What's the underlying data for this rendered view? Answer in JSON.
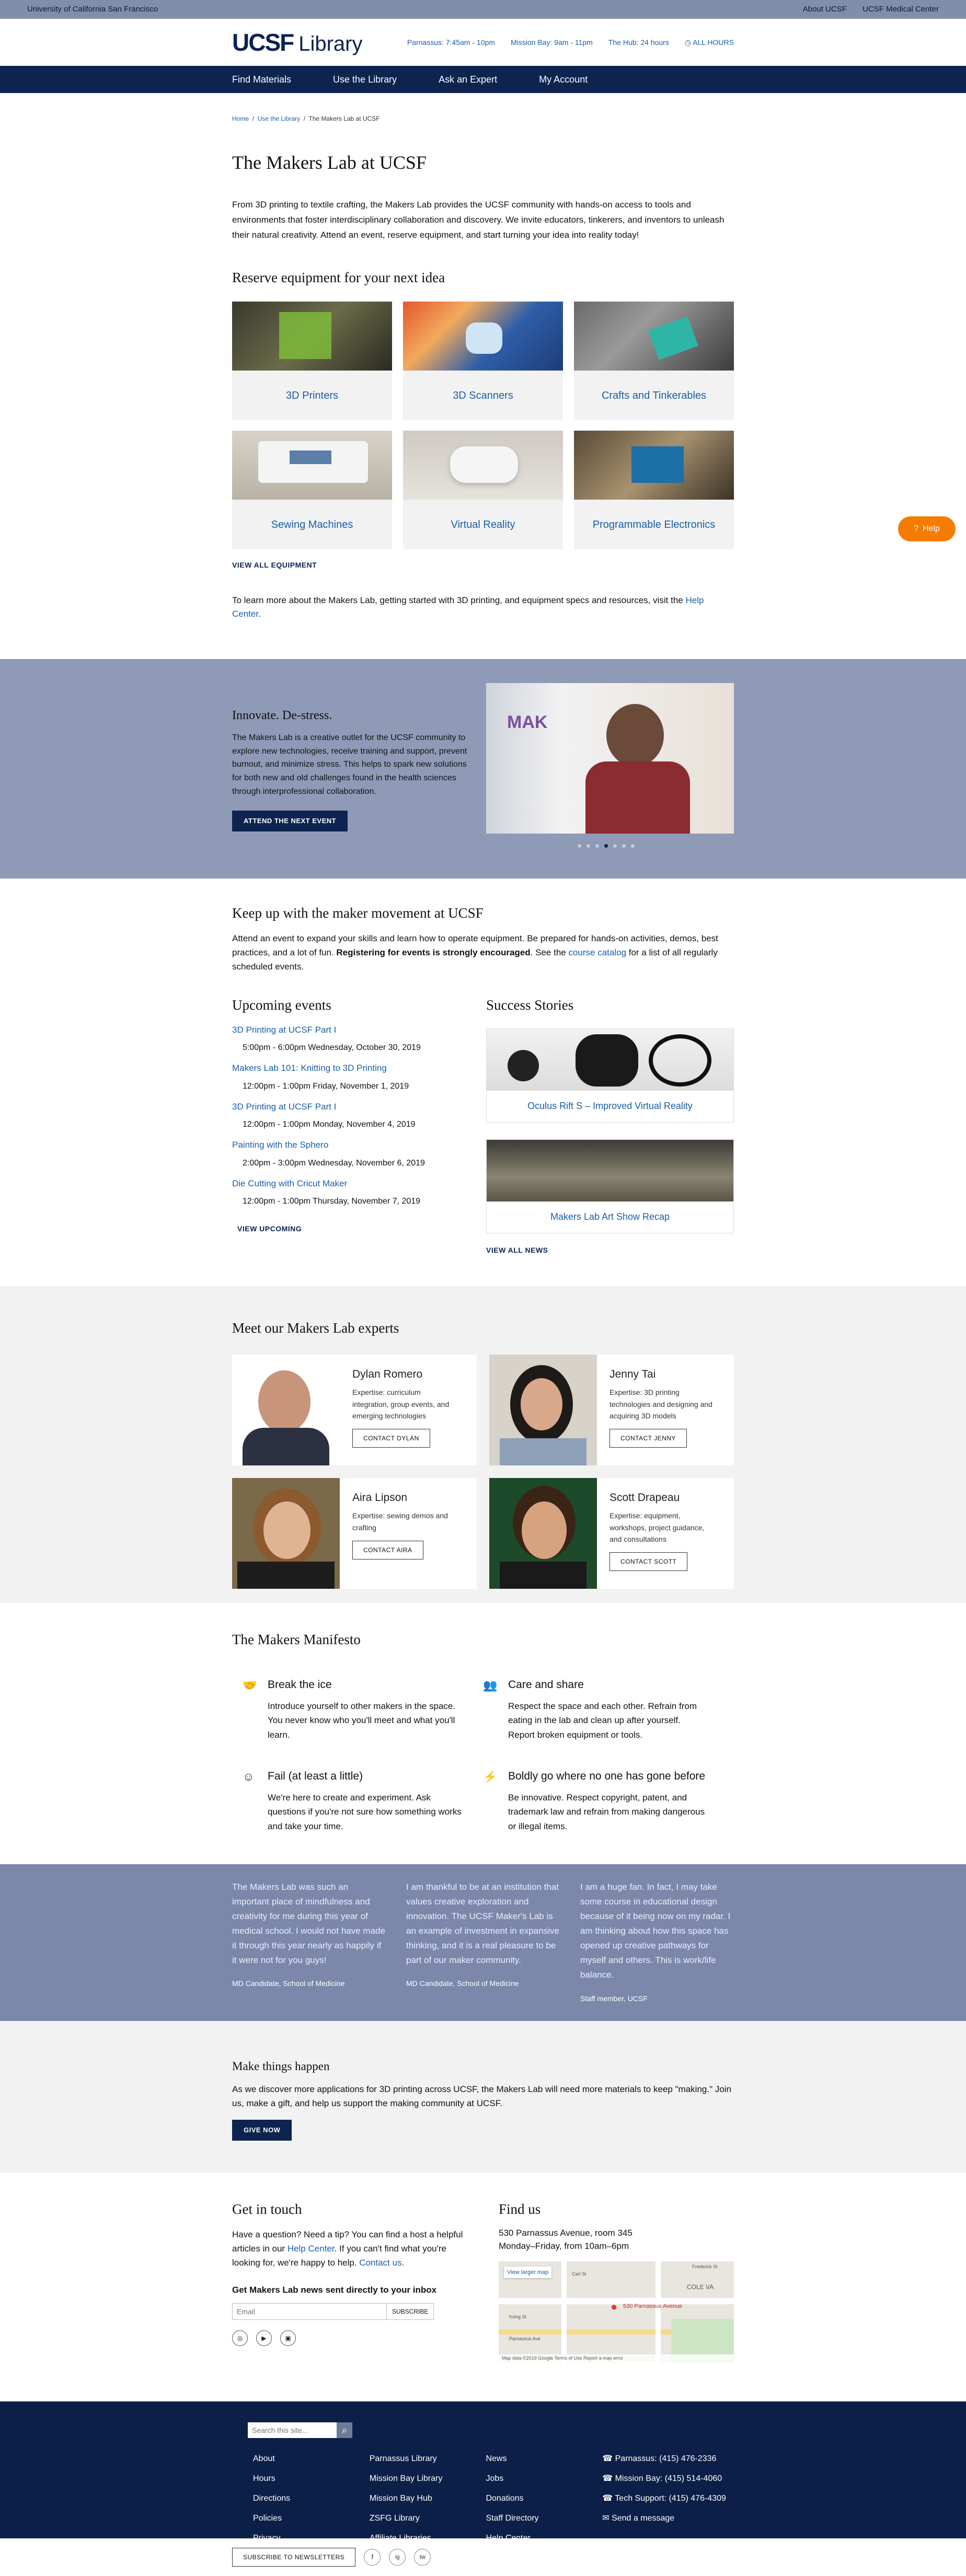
{
  "topbar": {
    "left": "University of California San Francisco",
    "links": [
      "About UCSF",
      "UCSF Medical Center"
    ]
  },
  "header": {
    "logo_ucsf": "UCSF",
    "logo_library": "Library",
    "hours": [
      "Parnassus: 7:45am - 10pm",
      "Mission Bay: 9am - 11pm",
      "The Hub: 24 hours",
      "ALL HOURS"
    ]
  },
  "nav": [
    "Find Materials",
    "Use the Library",
    "Ask an Expert",
    "My Account"
  ],
  "breadcrumb": [
    "Home",
    "Use the Library",
    "The Makers Lab at UCSF"
  ],
  "page_title": "The Makers Lab at UCSF",
  "intro": "From 3D printing to textile crafting, the Makers Lab provides the UCSF community with hands-on access to tools and environments that foster interdisciplinary collaboration and discovery. We invite educators, tinkerers, and inventors to unleash their natural creativity. Attend an event, reserve equipment, and start turning your idea into reality today!",
  "equipment": {
    "heading": "Reserve equipment for your next idea",
    "items": [
      "3D Printers",
      "3D Scanners",
      "Crafts and Tinkerables",
      "Sewing Machines",
      "Virtual Reality",
      "Programmable Electronics"
    ],
    "view_all": "VIEW ALL EQUIPMENT"
  },
  "learn_more": {
    "text": "To learn more about the Makers Lab, getting started with 3D printing, and equipment specs and resources, visit the ",
    "link": "Help Center",
    "end": "."
  },
  "help_button": "Help",
  "innovate": {
    "title": "Innovate. De-stress.",
    "text": "The Makers Lab is a creative outlet for the UCSF community to explore new technologies, receive training and support, prevent burnout, and minimize stress. This helps to spark new solutions for both new and old challenges found in the health sciences through interprofessional collaboration.",
    "button": "ATTEND THE NEXT EVENT",
    "sign": "MAK"
  },
  "keepup": {
    "heading": "Keep up with the maker movement at UCSF",
    "text1": "Attend an event to expand your skills and learn how to operate equipment. Be prepared for hands-on activities, demos, best practices, and a lot of fun. ",
    "bold": "Registering for events is strongly encouraged",
    "text2": ". See the ",
    "link": "course catalog",
    "text3": " for a list of all regularly scheduled events."
  },
  "events": {
    "heading": "Upcoming events",
    "items": [
      {
        "title": "3D Printing at UCSF Part I",
        "time": "5:00pm - 6:00pm Wednesday, October 30, 2019"
      },
      {
        "title": "Makers Lab 101: Knitting to 3D Printing",
        "time": "12:00pm - 1:00pm Friday, November 1, 2019"
      },
      {
        "title": "3D Printing at UCSF Part I",
        "time": "12:00pm - 1:00pm Monday, November 4, 2019"
      },
      {
        "title": "Painting with the Sphero",
        "time": "2:00pm - 3:00pm Wednesday, November 6, 2019"
      },
      {
        "title": "Die Cutting with Cricut Maker",
        "time": "12:00pm - 1:00pm Thursday, November 7, 2019"
      }
    ],
    "view": "VIEW UPCOMING"
  },
  "stories": {
    "heading": "Success Stories",
    "items": [
      "Oculus Rift S – Improved Virtual Reality",
      "Makers Lab Art Show Recap"
    ],
    "view": "VIEW ALL NEWS"
  },
  "experts": {
    "heading": "Meet our Makers Lab experts",
    "items": [
      {
        "name": "Dylan Romero",
        "expertise": "Expertise: curriculum integration, group events, and emerging technologies",
        "button": "CONTACT DYLAN"
      },
      {
        "name": "Jenny Tai",
        "expertise": "Expertise: 3D printing technologies and designing and acquiring 3D models",
        "button": "CONTACT JENNY"
      },
      {
        "name": "Aira Lipson",
        "expertise": "Expertise: sewing demos and crafting",
        "button": "CONTACT AIRA"
      },
      {
        "name": "Scott Drapeau",
        "expertise": "Expertise: equipment, workshops, project guidance, and consultations",
        "button": "CONTACT SCOTT"
      }
    ]
  },
  "manifesto": {
    "heading": "The Makers Manifesto",
    "items": [
      {
        "title": "Break the ice",
        "text": "Introduce yourself to other makers in the space. You never know who you'll meet and what you'll learn.",
        "icon": "handshake-icon"
      },
      {
        "title": "Care and share",
        "text": "Respect the space and each other. Refrain from eating in the lab and clean up after yourself. Report broken equipment or tools.",
        "icon": "users-icon"
      },
      {
        "title": "Fail (at least a little)",
        "text": "We're here to create and experiment. Ask questions if you're not sure how something works and take your time.",
        "icon": "smile-icon"
      },
      {
        "title": "Boldly go where no one has gone before",
        "text": "Be innovative. Respect copyright, patent, and trademark law and refrain from making dangerous or illegal items.",
        "icon": "bolt-icon"
      }
    ]
  },
  "quotes": [
    {
      "text": "The Makers Lab was such an important place of mindfulness and creativity for me during this year of medical school. I would not have made it through this year nearly as happily if it were not for you guys!",
      "by": "MD Candidate, School of Medicine"
    },
    {
      "text": "I am thankful to be at an institution that values creative exploration and innovation. The UCSF Maker's Lab is an example of investment in expansive thinking, and it is a real pleasure to be part of our maker community.",
      "by": "MD Candidate, School of Medicine"
    },
    {
      "text": "I am a huge fan. In fact, I may take some course in educational design because of it being now on my radar. I am thinking about how this space has opened up creative pathways for myself and others. This is work/life balance.",
      "by": "Staff member, UCSF"
    }
  ],
  "give": {
    "heading": "Make things happen",
    "text": "As we discover more applications for 3D printing across UCSF, the Makers Lab will need more materials to keep \"making.\" Join us, make a gift, and help us support the making community at UCSF.",
    "button": "GIVE NOW"
  },
  "contact": {
    "heading": "Get in touch",
    "t1": "Have a question? Need a tip? You can find a host a helpful articles in our ",
    "link1": "Help Center",
    "t2": ". If you can't find what you're looking for, we're happy to help. ",
    "link2": "Contact us",
    "t3": ".",
    "news": "Get Makers Lab news sent directly to your inbox",
    "email_ph": "Email",
    "subscribe": "SUBSCRIBE"
  },
  "findus": {
    "heading": "Find us",
    "address": "530 Parnassus Avenue, room 345",
    "hours": "Monday–Friday, from 10am–6pm",
    "map_link": "View larger map",
    "map_pin": "530 Parnassus Avenue",
    "map_labels": [
      "COLE VA",
      "Frederick St",
      "Carl St",
      "Irving St",
      "Parnassus Ave"
    ],
    "map_footer": "Map data ©2019 Google   Terms of Use   Report a map error"
  },
  "footer": {
    "search_ph": "Search this site...",
    "cols": [
      [
        "About",
        "Hours",
        "Directions",
        "Policies",
        "Privacy"
      ],
      [
        "Parnassus Library",
        "Mission Bay Library",
        "Mission Bay Hub",
        "ZSFG Library",
        "Affiliate Libraries"
      ],
      [
        "News",
        "Jobs",
        "Donations",
        "Staff Directory",
        "Help Center"
      ],
      [
        "Parnassus: (415) 476-2336",
        "Mission Bay: (415) 514-4060",
        "Tech Support: (415) 476-4309",
        "Send a message"
      ]
    ],
    "subscribe": "SUBSCRIBE TO NEWSLETTERS",
    "social": [
      "f",
      "ig",
      "tw"
    ]
  },
  "colors": {
    "navy": "#0d2350",
    "link": "#1a5ea8",
    "band": "#8f9ab7",
    "quotes": "#7b88aa",
    "help": "#f57c00"
  }
}
